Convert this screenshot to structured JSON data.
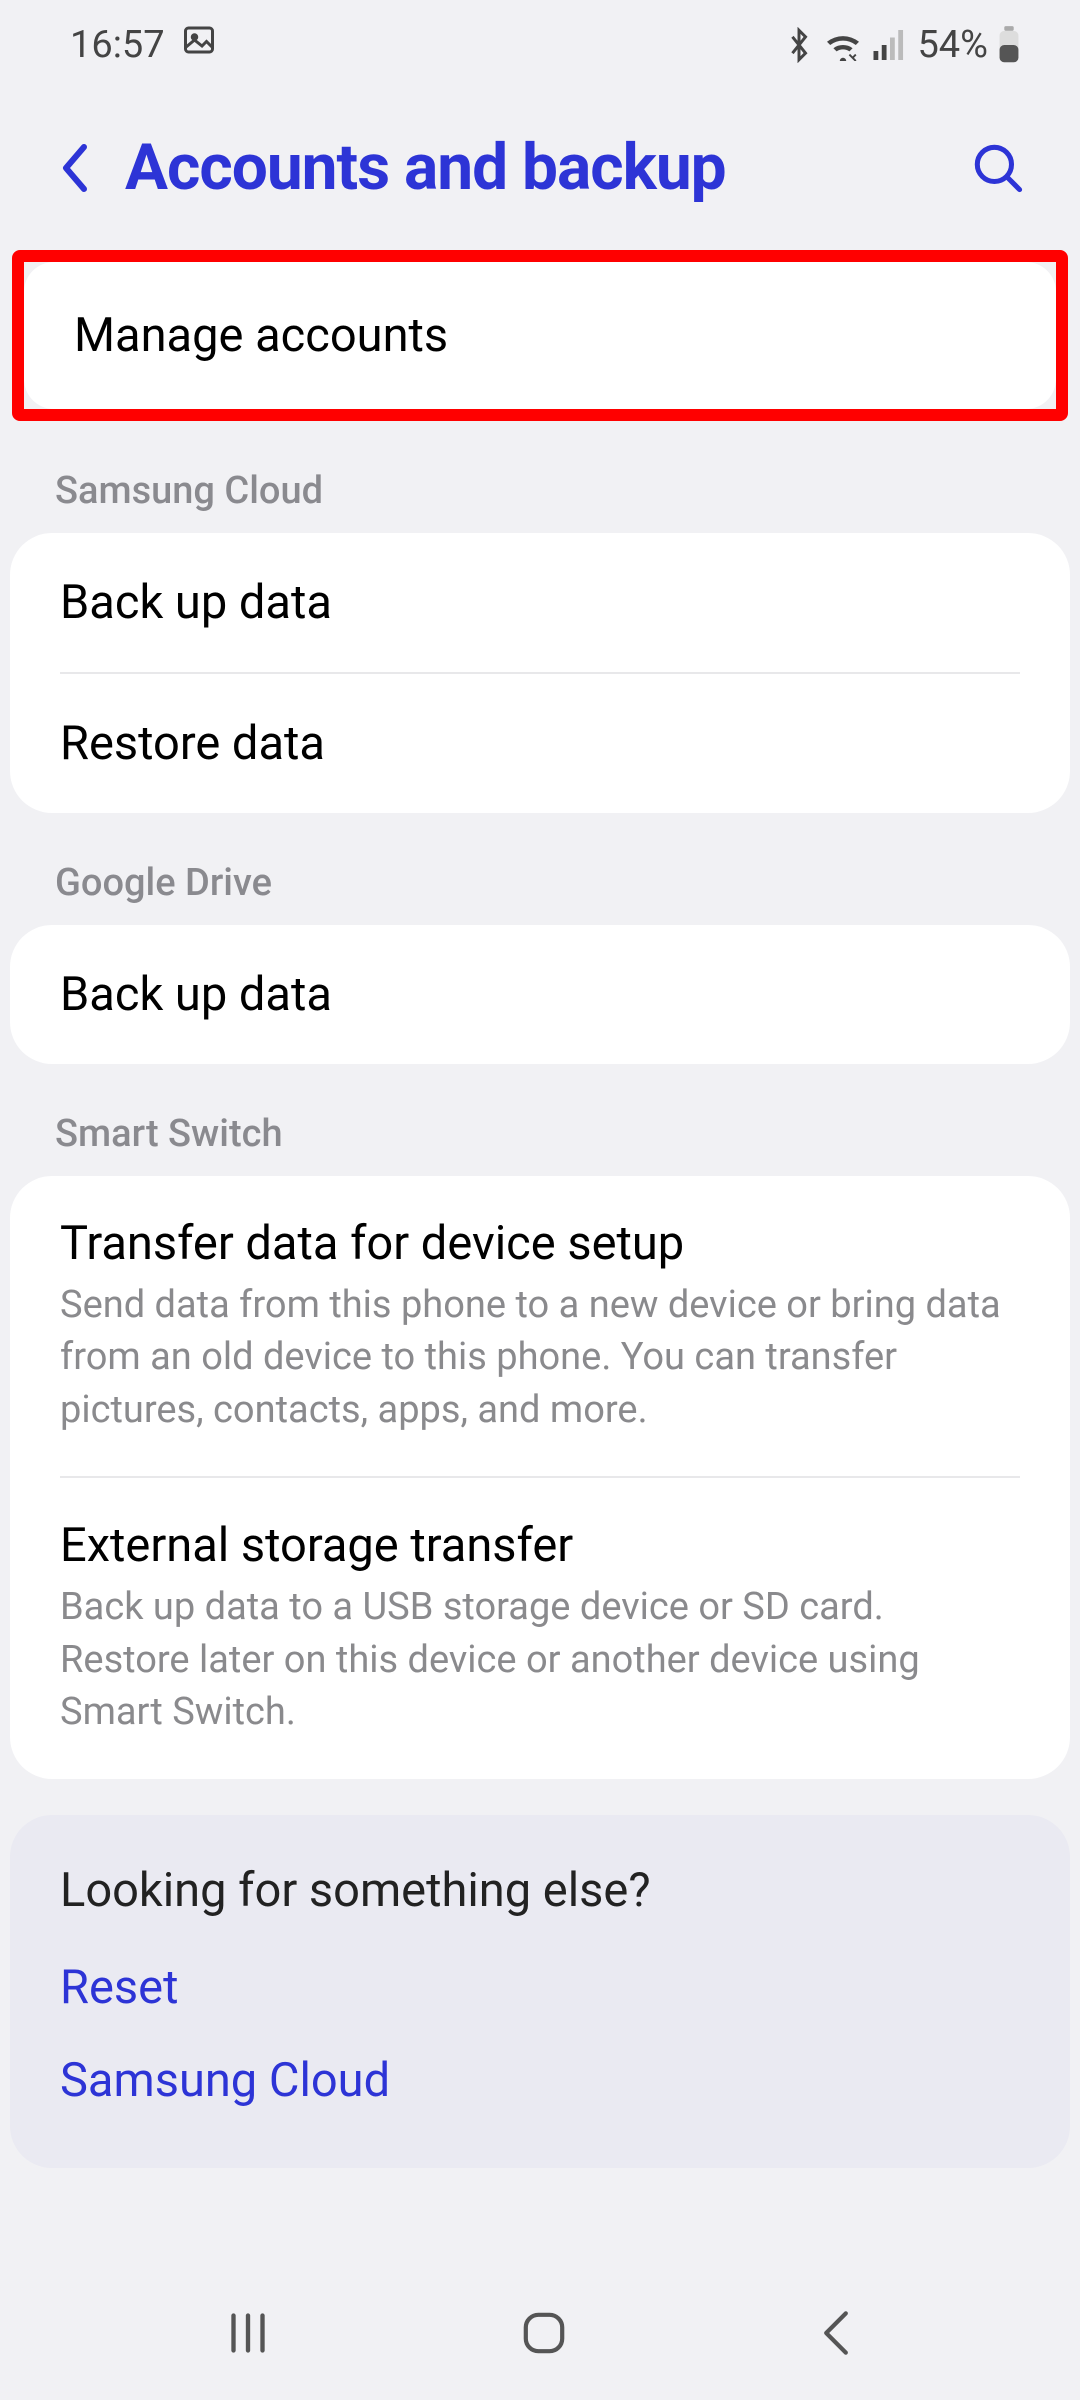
{
  "status": {
    "time": "16:57",
    "battery_pct": "54%"
  },
  "header": {
    "title": "Accounts and backup"
  },
  "highlight": {
    "label": "Manage accounts"
  },
  "sections": {
    "samsung_cloud": {
      "header": "Samsung Cloud",
      "items": {
        "backup": "Back up data",
        "restore": "Restore data"
      }
    },
    "google_drive": {
      "header": "Google Drive",
      "items": {
        "backup": "Back up data"
      }
    },
    "smart_switch": {
      "header": "Smart Switch",
      "items": {
        "transfer": {
          "title": "Transfer data for device setup",
          "desc": "Send data from this phone to a new device or bring data from an old device to this phone. You can transfer pictures, contacts, apps, and more."
        },
        "external": {
          "title": "External storage transfer",
          "desc": "Back up data to a USB storage device or SD card. Restore later on this device or another device using Smart Switch."
        }
      }
    }
  },
  "footer": {
    "heading": "Looking for something else?",
    "links": {
      "reset": "Reset",
      "samsung_cloud": "Samsung Cloud"
    }
  }
}
